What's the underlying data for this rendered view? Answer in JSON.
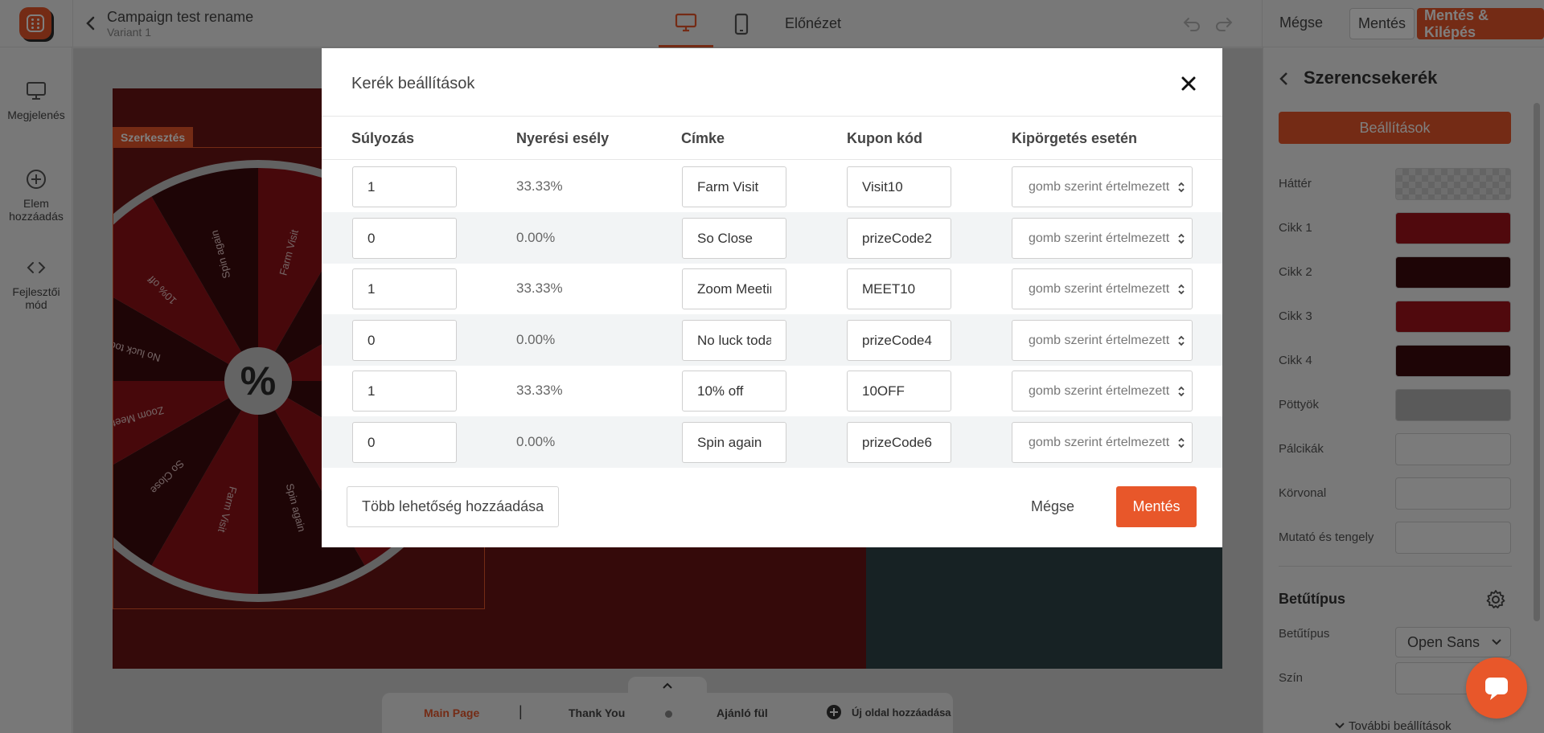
{
  "topbar": {
    "campaign_title": "Campaign test rename",
    "variant": "Variant 1",
    "preview_label": "Előnézet",
    "cancel_label": "Mégse",
    "save_label": "Mentés",
    "save_exit_label": "Mentés & Kilépés"
  },
  "leftnav": {
    "items": [
      {
        "label": "Megjelenés",
        "icon": "monitor-icon"
      },
      {
        "label": "Elem hozzáadás",
        "icon": "plus-circle-icon"
      },
      {
        "label": "Fejlesztői mód",
        "icon": "code-icon"
      }
    ]
  },
  "canvas": {
    "edit_tag": "Szerkesztés",
    "wheel_center": "%",
    "wheel_labels": [
      "Farm Visit",
      "So Close",
      "Zoom Meeting",
      "No luck today",
      "10% off",
      "Spin again"
    ],
    "colors": {
      "primary": "#8f1117",
      "secondary": "#3d0a0d",
      "background": "#6b1515",
      "panel": "#2f4448"
    }
  },
  "pages": {
    "items": [
      "Main Page",
      "Thank You",
      "Ajánló fül"
    ],
    "add_label": "Új oldal hozzáadása"
  },
  "right_panel": {
    "title": "Szerencsekerék",
    "settings_button": "Beállítások",
    "rows": [
      {
        "label": "Háttér",
        "color": "transparent"
      },
      {
        "label": "Cikk 1",
        "color": "#a0121a"
      },
      {
        "label": "Cikk 2",
        "color": "#3d0a0d"
      },
      {
        "label": "Cikk 3",
        "color": "#a0121a"
      },
      {
        "label": "Cikk 4",
        "color": "#3d0a0d"
      },
      {
        "label": "Pöttyök",
        "color": "#b5b5b5"
      },
      {
        "label": "Pálcikák",
        "color": "#f7f7f7"
      },
      {
        "label": "Körvonal",
        "color": "#f7f7f7"
      },
      {
        "label": "Mutató és tengely",
        "color": "#f7f7f7"
      }
    ],
    "font_section": "Betűtípus",
    "font_label": "Betűtípus",
    "font_value": "Open Sans",
    "color_label": "Szín",
    "more_settings": "További beállítások"
  },
  "modal": {
    "title": "Kerék beállítások",
    "columns": [
      "Súlyozás",
      "Nyerési esély",
      "Címke",
      "Kupon kód",
      "Kipörgetés esetén"
    ],
    "rows": [
      {
        "weight": "1",
        "chance": "33.33%",
        "label": "Farm Visit",
        "coupon": "Visit10",
        "action": "gomb szerint értelmezett"
      },
      {
        "weight": "0",
        "chance": "0.00%",
        "label": "So Close",
        "coupon": "prizeCode2",
        "action": "gomb szerint értelmezett"
      },
      {
        "weight": "1",
        "chance": "33.33%",
        "label": "Zoom Meeting",
        "coupon": "MEET10",
        "action": "gomb szerint értelmezett"
      },
      {
        "weight": "0",
        "chance": "0.00%",
        "label": "No luck today",
        "coupon": "prizeCode4",
        "action": "gomb szerint értelmezett"
      },
      {
        "weight": "1",
        "chance": "33.33%",
        "label": "10% off",
        "coupon": "10OFF",
        "action": "gomb szerint értelmezett"
      },
      {
        "weight": "0",
        "chance": "0.00%",
        "label": "Spin again",
        "coupon": "prizeCode6",
        "action": "gomb szerint értelmezett"
      }
    ],
    "add_more_label": "Több lehetőség hozzáadása",
    "cancel_label": "Mégse",
    "save_label": "Mentés"
  }
}
